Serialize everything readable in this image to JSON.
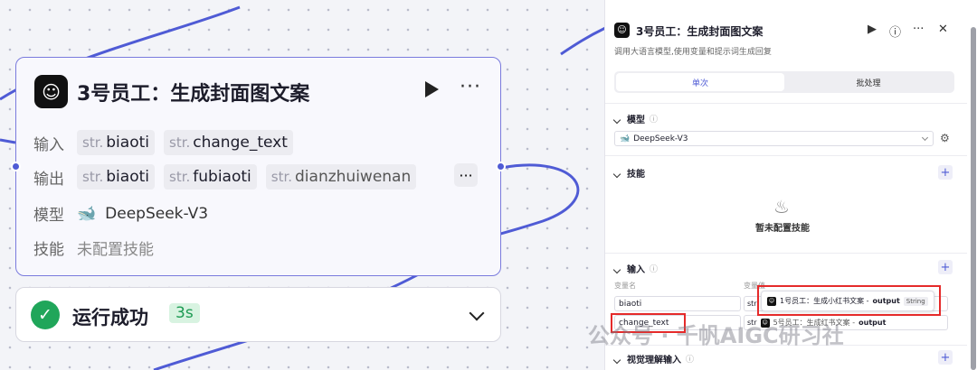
{
  "node": {
    "title": "3号员工：生成封面图文案",
    "input_label": "输入",
    "output_label": "输出",
    "model_label": "模型",
    "skill_label": "技能",
    "type_prefix": "str.",
    "inputs": [
      "biaoti",
      "change_text"
    ],
    "outputs": [
      "biaoti",
      "fubiaoti",
      "dianzhuiwenan"
    ],
    "model_name": "DeepSeek-V3",
    "skill_value": "未配置技能",
    "more": "···"
  },
  "status": {
    "text": "运行成功",
    "time": "3s"
  },
  "panel": {
    "title": "3号员工：生成封面图文案",
    "description": "调用大语言模型,使用变量和提示词生成回复",
    "tabs": [
      "单次",
      "批处理"
    ],
    "model_section": "模型",
    "model_value": "DeepSeek-V3",
    "skills_section": "技能",
    "skills_empty": "暂未配置技能",
    "input_section": "输入",
    "col_var_name": "变量名",
    "col_var_value": "变量值",
    "rows": [
      {
        "name": "biaoti",
        "value_prefix": "str",
        "ref_text": "1号员工：生成小红书文案 - ",
        "ref_var": "output",
        "ref_type": "String"
      },
      {
        "name": "change_text",
        "value_prefix": "str",
        "ref_text": "5号员工：生成红书文案 - ",
        "ref_var": "output",
        "ref_type": ""
      }
    ],
    "vision_section": "视觉理解输入"
  },
  "watermark": "公众号 · 千帆AIGC研习社",
  "colors": {
    "accent": "#4f5bd5",
    "node_border": "#7a7bdd",
    "success": "#20a65a",
    "highlight": "#e52a2a"
  }
}
